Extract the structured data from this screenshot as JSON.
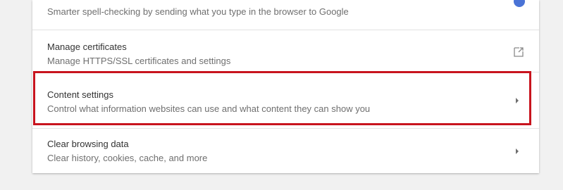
{
  "settings": {
    "items": [
      {
        "title": "",
        "subtitle": "Smarter spell-checking by sending what you type in the browser to Google",
        "control": "toggle",
        "toggle_state": "off",
        "toggle_color": "#4a73d6"
      },
      {
        "title": "Manage certificates",
        "subtitle": "Manage HTTPS/SSL certificates and settings",
        "control": "open-in-new-icon"
      },
      {
        "title": "Content settings",
        "subtitle": "Control what information websites can use and what content they can show you",
        "control": "chevron-right-icon",
        "highlighted": true
      },
      {
        "title": "Clear browsing data",
        "subtitle": "Clear history, cookies, cache, and more",
        "control": "chevron-right-icon"
      }
    ],
    "highlight_color": "#c8141e"
  }
}
